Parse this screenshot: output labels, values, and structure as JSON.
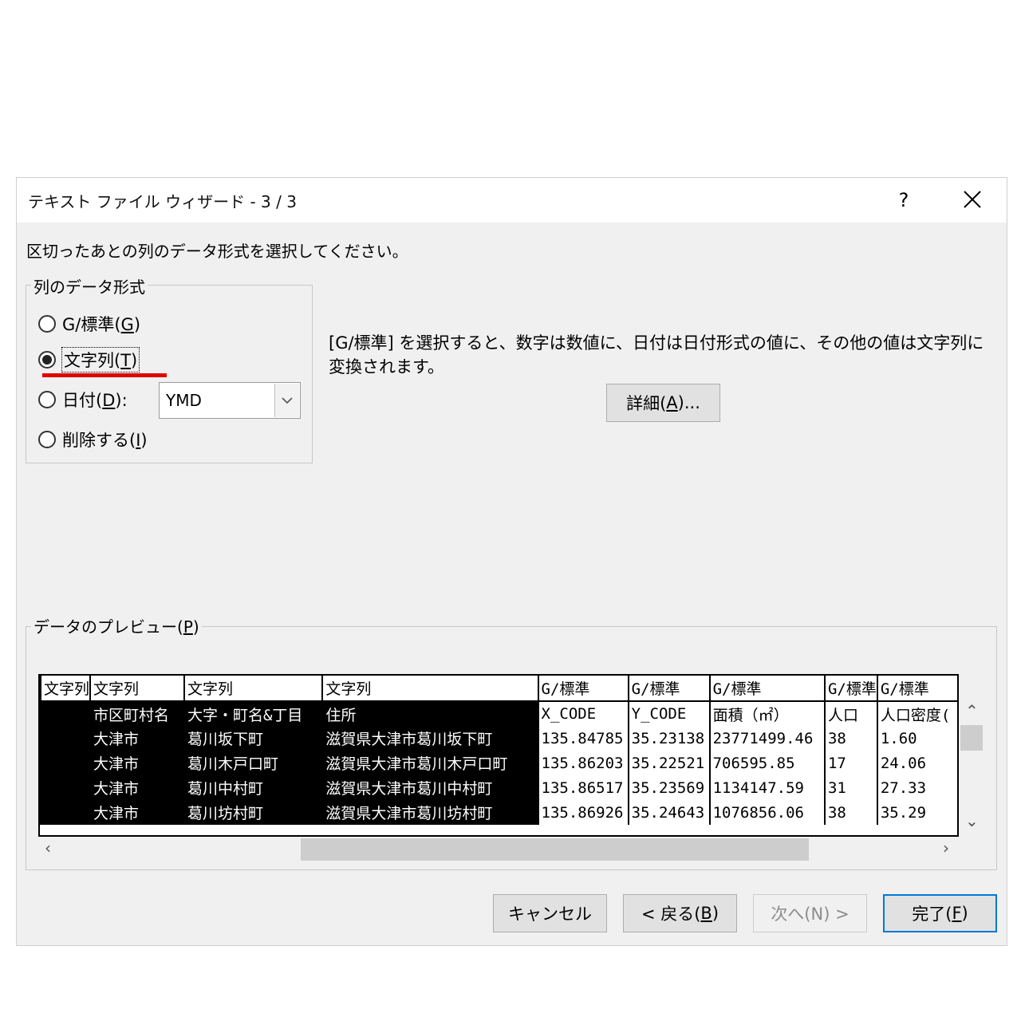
{
  "window": {
    "title": "テキスト ファイル ウィザード - 3 / 3",
    "help_label": "?",
    "icons": {
      "help": "question-mark-icon",
      "close": "close-x-icon"
    }
  },
  "instruction": "区切ったあとの列のデータ形式を選択してください。",
  "format_group": {
    "label": "列のデータ形式",
    "options": [
      {
        "prefix": "G/標準(",
        "key": "G",
        "suffix": ")",
        "checked": false
      },
      {
        "prefix": "文字列(",
        "key": "T",
        "suffix": ")",
        "checked": true
      },
      {
        "prefix": "日付(",
        "key": "D",
        "suffix": "):",
        "checked": false
      },
      {
        "prefix": "削除する(",
        "key": "I",
        "suffix": ")",
        "checked": false
      }
    ],
    "date_format": "YMD"
  },
  "description": "[G/標準] を選択すると、数字は数値に、日付は日付形式の値に、その他の値は文字列に変換されます。",
  "advanced_button": {
    "prefix": "詳細(",
    "key": "A",
    "suffix": ")..."
  },
  "preview": {
    "label_prefix": "データのプレビュー(",
    "label_key": "P",
    "label_suffix": ")",
    "formats": [
      "文字列",
      "文字列",
      "文字列",
      "文字列",
      "G/標準",
      "G/標準",
      "G/標準",
      "G/標準",
      "G/標準"
    ],
    "rows": [
      [
        "",
        "市区町村名",
        "大字・町名&丁目",
        "住所",
        "X_CODE",
        "Y_CODE",
        "面積（㎡）",
        "人口",
        "人口密度("
      ],
      [
        "",
        "大津市",
        "葛川坂下町",
        "滋賀県大津市葛川坂下町",
        "135.84785",
        "35.23138",
        "23771499.46",
        "38",
        "1.60"
      ],
      [
        "",
        "大津市",
        "葛川木戸口町",
        "滋賀県大津市葛川木戸口町",
        "135.86203",
        "35.22521",
        "706595.85",
        "17",
        "24.06"
      ],
      [
        "",
        "大津市",
        "葛川中村町",
        "滋賀県大津市葛川中村町",
        "135.86517",
        "35.23569",
        "1134147.59",
        "31",
        "27.33"
      ],
      [
        "",
        "大津市",
        "葛川坊村町",
        "滋賀県大津市葛川坊村町",
        "135.86926",
        "35.24643",
        "1076856.06",
        "38",
        "35.29"
      ]
    ],
    "selected_columns": [
      0,
      1,
      2,
      3
    ]
  },
  "buttons": {
    "cancel": {
      "label": "キャンセル"
    },
    "back": {
      "prefix": "< 戻る(",
      "key": "B",
      "suffix": ")"
    },
    "next": {
      "label": "次へ(N) >"
    },
    "finish": {
      "prefix": "完了(",
      "key": "F",
      "suffix": ")"
    }
  }
}
